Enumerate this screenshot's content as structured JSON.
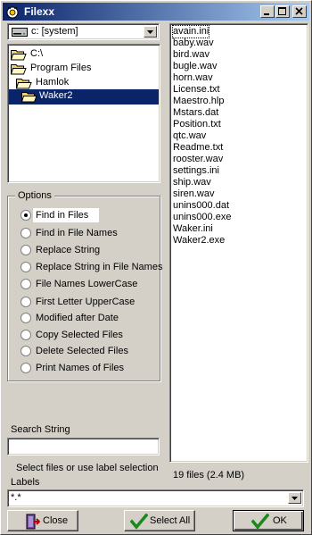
{
  "window": {
    "title": "Filexx"
  },
  "drive": {
    "value": "c: [system]"
  },
  "tree": {
    "items": [
      {
        "label": "C:\\"
      },
      {
        "label": "Program Files"
      },
      {
        "label": "Hamlok"
      },
      {
        "label": "Waker2",
        "selected": true
      }
    ]
  },
  "options": {
    "legend": "Options",
    "items": [
      {
        "label": "Find in Files",
        "checked": true
      },
      {
        "label": "Find in File Names"
      },
      {
        "label": "Replace String"
      },
      {
        "label": "Replace String in File Names"
      },
      {
        "label": "File Names LowerCase"
      },
      {
        "label": "First Letter UpperCase"
      },
      {
        "label": "Modified after Date"
      },
      {
        "label": "Copy Selected Files"
      },
      {
        "label": "Delete Selected Files"
      },
      {
        "label": "Print Names of Files"
      }
    ]
  },
  "search": {
    "label": "Search String",
    "value": ""
  },
  "hint": "Select files or use label selection",
  "labels": {
    "label": "Labels",
    "value": "*.*"
  },
  "files": [
    "avain.ini",
    "baby.wav",
    "bird.wav",
    "bugle.wav",
    "horn.wav",
    "License.txt",
    "Maestro.hlp",
    "Mstars.dat",
    "Position.txt",
    "qtc.wav",
    "Readme.txt",
    "rooster.wav",
    "settings.ini",
    "ship.wav",
    "siren.wav",
    "unins000.dat",
    "unins000.exe",
    "Waker.ini",
    "Waker2.exe"
  ],
  "status": "19 files  (2.4 MB)",
  "buttons": {
    "close": "Close",
    "select_all": "Select All",
    "ok": "OK"
  },
  "colors": {
    "titlebar": "#0a246a",
    "selection": "#0a246a",
    "face": "#d4d0c8",
    "ok_check": "#1a8a1a"
  }
}
